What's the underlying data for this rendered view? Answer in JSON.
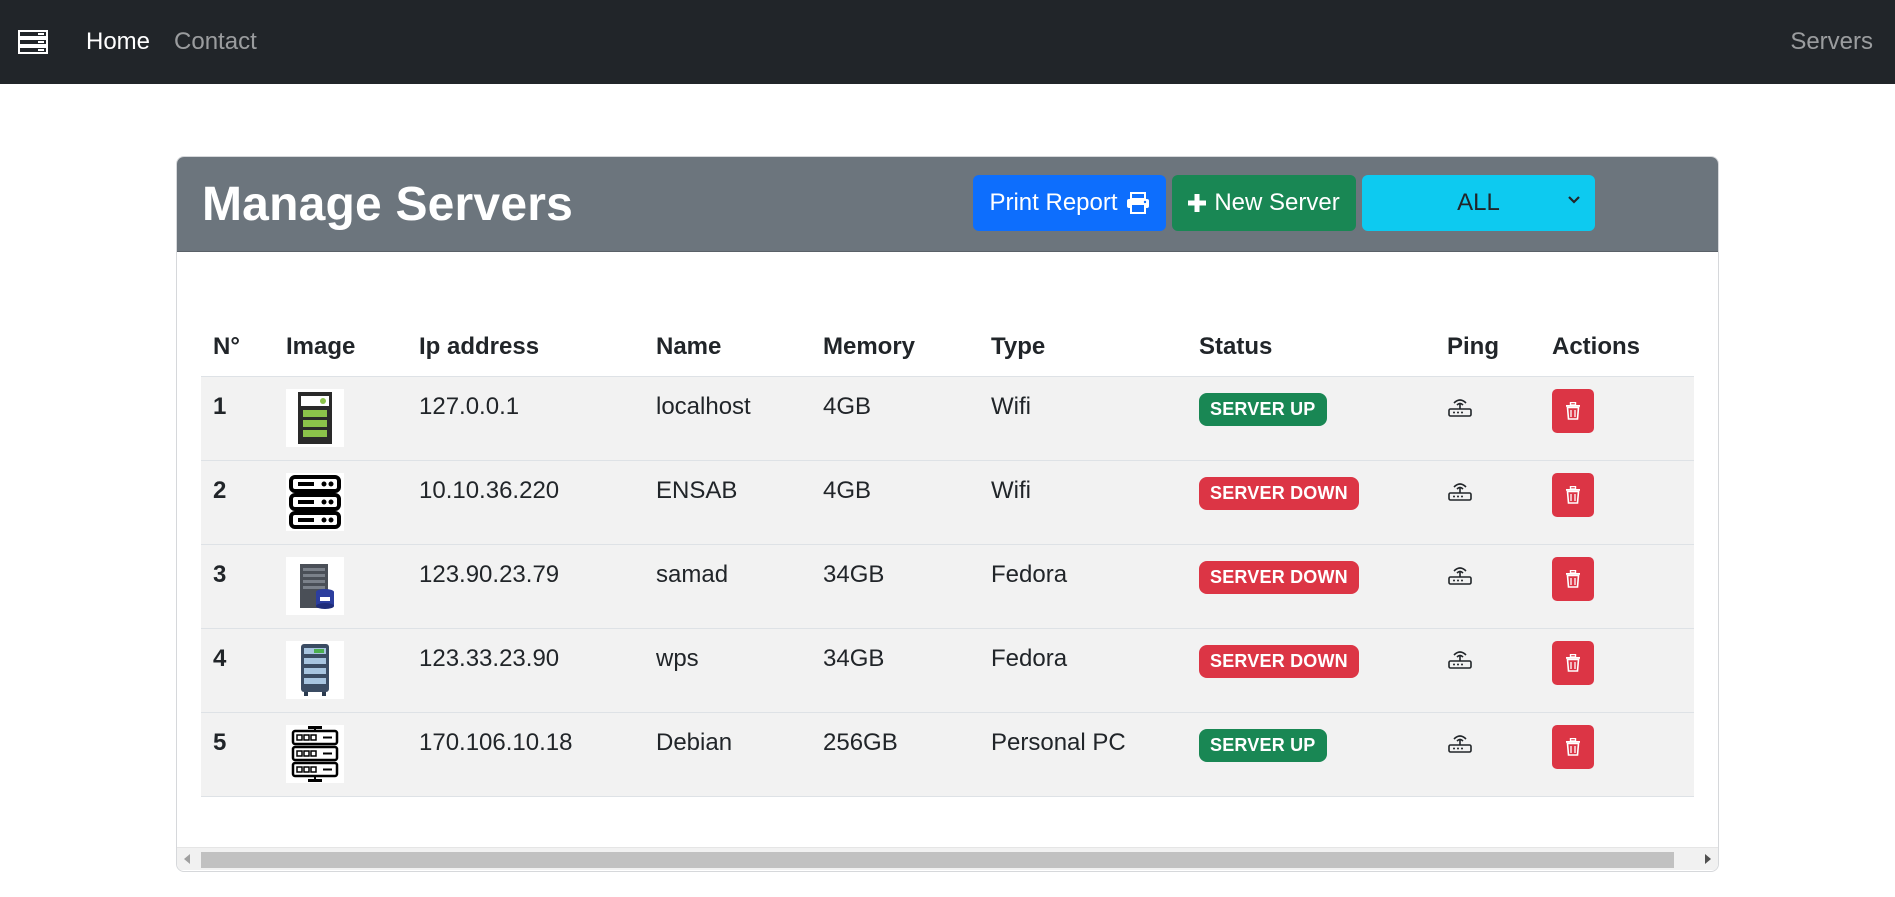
{
  "navbar": {
    "brand_icon": "server-stack-icon",
    "links": [
      {
        "label": "Home",
        "active": true
      },
      {
        "label": "Contact",
        "active": false
      }
    ],
    "right_link": "Servers"
  },
  "card": {
    "title": "Manage Servers",
    "print_button": "Print Report",
    "print_icon": "printer-icon",
    "new_button": "New Server",
    "new_icon": "plus-icon",
    "filter": {
      "selected": "ALL"
    }
  },
  "table": {
    "headers": [
      "N°",
      "Image",
      "Ip address",
      "Name",
      "Memory",
      "Type",
      "Status",
      "Ping",
      "Actions"
    ],
    "rows": [
      {
        "num": "1",
        "image": "server-tower-green-icon",
        "ip": "127.0.0.1",
        "name": "localhost",
        "memory": "4GB",
        "type": "Wifi",
        "status": "SERVER UP",
        "status_color": "#198754"
      },
      {
        "num": "2",
        "image": "server-rack-outline-icon",
        "ip": "10.10.36.220",
        "name": "ENSAB",
        "memory": "4GB",
        "type": "Wifi",
        "status": "SERVER DOWN",
        "status_color": "#dc3545"
      },
      {
        "num": "3",
        "image": "server-database-icon",
        "ip": "123.90.23.79",
        "name": "samad",
        "memory": "34GB",
        "type": "Fedora",
        "status": "SERVER DOWN",
        "status_color": "#dc3545"
      },
      {
        "num": "4",
        "image": "server-cabinet-blue-icon",
        "ip": "123.33.23.90",
        "name": "wps",
        "memory": "34GB",
        "type": "Fedora",
        "status": "SERVER DOWN",
        "status_color": "#dc3545"
      },
      {
        "num": "5",
        "image": "server-network-icon",
        "ip": "170.106.10.18",
        "name": "Debian",
        "memory": "256GB",
        "type": "Personal PC",
        "status": "SERVER UP",
        "status_color": "#198754"
      }
    ],
    "ping_icon": "router-icon",
    "delete_icon": "trash-icon"
  },
  "colors": {
    "navbar_bg": "#212529",
    "header_bg": "#6c757d",
    "primary": "#0d6efd",
    "success": "#198754",
    "info": "#0dcaf0",
    "danger": "#dc3545"
  }
}
